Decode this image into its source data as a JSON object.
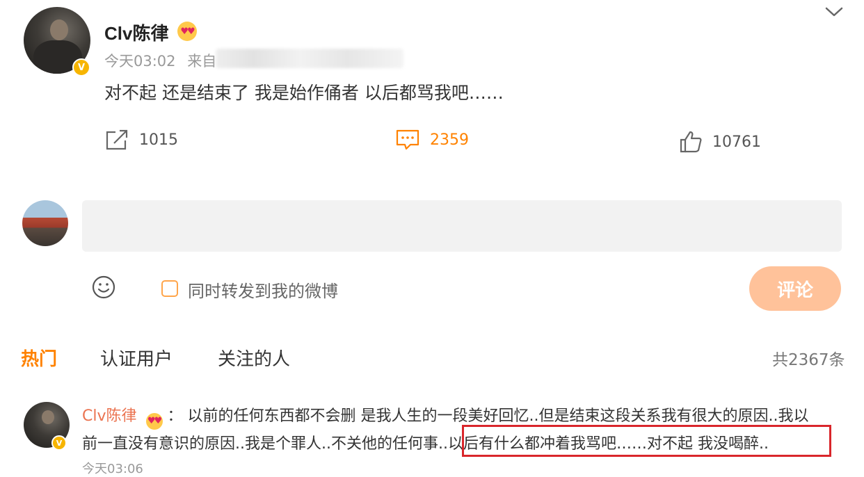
{
  "post": {
    "username": "Clv陈律",
    "time": "今天03:02",
    "source_prefix": "来自",
    "text": "对不起 还是结束了 我是始作俑者 以后都骂我吧……",
    "verified_badge": "V",
    "emoji_icon": "heart-eyes-emoji"
  },
  "actions": {
    "repost_count": "1015",
    "comment_count": "2359",
    "like_count": "10761",
    "accent_color": "#ff8200"
  },
  "composer": {
    "input_placeholder": "",
    "repost_option_label": "同时转发到我的微博",
    "submit_label": "评论"
  },
  "tabs": {
    "items": [
      "热门",
      "认证用户",
      "关注的人"
    ],
    "active": "热门",
    "total_label": "共2367条"
  },
  "comment": {
    "username": "Clv陈律",
    "separator": "：",
    "line1": "以前的任何东西都不会删 是我人生的一段美好回忆..但是结束这段关系我有很大的原因..我以",
    "line2_a": "前一直没有意识的原因..我是个罪人..不关他的任何事",
    "line2_b": "..以后有什么都冲着我骂吧……对不起 我没喝醉..",
    "time_partial": "今天03:06",
    "highlight_color": "#d9262b"
  }
}
